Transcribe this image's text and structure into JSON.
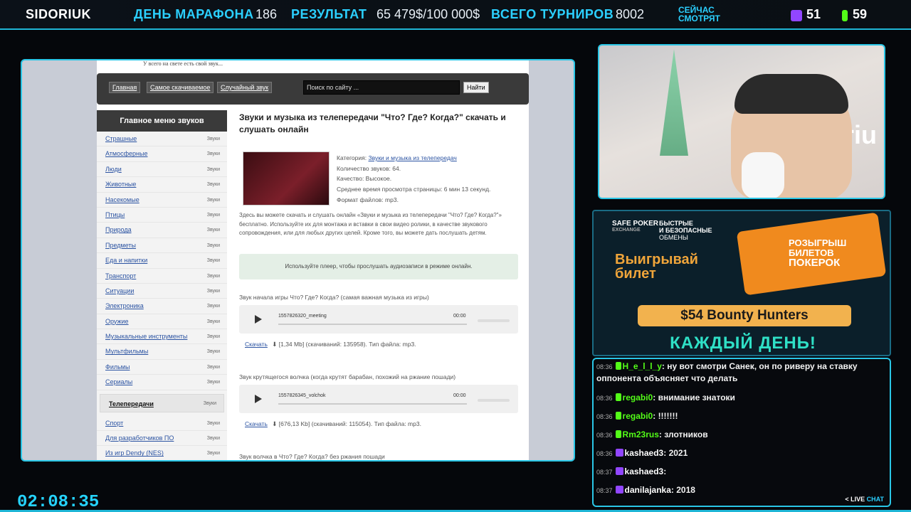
{
  "topbar": {
    "brand": "SIDORIUK",
    "marathon_label": "ДЕНЬ МАРАФОНА",
    "marathon_value": "186",
    "result_label": "РЕЗУЛЬТАТ",
    "result_value": "65 479$/100 000$",
    "tournaments_label": "ВСЕГО ТУРНИРОВ",
    "tournaments_value": "8002",
    "watching_line1": "СЕЙЧАС",
    "watching_line2": "СМОТРЯТ",
    "twitch_count": "51",
    "kick_count": "59"
  },
  "site": {
    "tagline": "У всего на свете есть свой звук...",
    "nav": [
      "Главная",
      "Самое скачиваемое",
      "Случайный звук"
    ],
    "search_placeholder": "Поиск по сайту ...",
    "search_button": "Найти",
    "menu_title": "Главное меню звуков",
    "menu_items": [
      {
        "label": "Страшные",
        "tag": "Звуки"
      },
      {
        "label": "Атмосферные",
        "tag": "Звуки"
      },
      {
        "label": "Люди",
        "tag": "Звуки"
      },
      {
        "label": "Животные",
        "tag": "Звуки"
      },
      {
        "label": "Насекомые",
        "tag": "Звуки"
      },
      {
        "label": "Птицы",
        "tag": "Звуки"
      },
      {
        "label": "Природа",
        "tag": "Звуки"
      },
      {
        "label": "Предметы",
        "tag": "Звуки"
      },
      {
        "label": "Еда и напитки",
        "tag": "Звуки"
      },
      {
        "label": "Транспорт",
        "tag": "Звуки"
      },
      {
        "label": "Ситуации",
        "tag": "Звуки"
      },
      {
        "label": "Электроника",
        "tag": "Звуки"
      },
      {
        "label": "Оружие",
        "tag": "Звуки"
      },
      {
        "label": "Музыкальные инструменты",
        "tag": "Звуки"
      },
      {
        "label": "Мультфильмы",
        "tag": "Звуки"
      },
      {
        "label": "Фильмы",
        "tag": "Звуки"
      },
      {
        "label": "Сериалы",
        "tag": "Звуки"
      },
      {
        "label": "Телепередачи",
        "tag": "Звуки",
        "active": true
      },
      {
        "label": "Спорт",
        "tag": "Звуки"
      },
      {
        "label": "Для разработчиков ПО",
        "tag": "Звуки"
      },
      {
        "label": "Из игр Dendy (NES)",
        "tag": "Звуки"
      }
    ],
    "page_title": "Звуки и музыка из телепередачи \"Что? Где? Когда?\" скачать и слушать онлайн",
    "meta": {
      "category_label": "Категория:",
      "category_link": "Звуки и музыка из телепередач",
      "count": "Количество звуков: 64.",
      "quality": "Качество: Высокое.",
      "avg_time": "Среднее время просмотра страницы: 6 мин 13 секунд.",
      "format": "Формат файлов: mp3."
    },
    "description": "Здесь вы можете скачать и слушать онлайн «Звуки и музыка из телепередачи \"Что? Где? Когда?\"» бесплатно. Используйте их для монтажа и вставки в свои видео ролики, в качестве звукового сопровождения, или для любых других целей. Кроме того, вы можете дать послушать детям.",
    "info_box": "Используйте плеер, чтобы прослушать аудиозаписи в режиме онлайн.",
    "tracks": [
      {
        "title": "Звук начала игры Что? Где? Когда? (самая важная музыка из игры)",
        "file": "1557826320_meeting",
        "time": "00:00",
        "download": "Скачать",
        "details": "[1,34 Mb] (скачиваний: 135958). Тип файла: mp3."
      },
      {
        "title": "Звук крутящегося волчка (когда крутят барабан, похожий на ржание пошади)",
        "file": "1557826345_volchok",
        "time": "00:00",
        "download": "Скачать",
        "details": "[676,13 Kb] (скачиваний: 115054). Тип файла: mp3."
      },
      {
        "title": "Звук волчка в Что? Где? Когда? без ржания пошади"
      }
    ]
  },
  "ad": {
    "brand_a": "SAFE POKER",
    "brand_b": "EXCHANGE",
    "tagline_1": "БЫСТРЫЕ",
    "tagline_2": "И БЕЗОПАСНЫЕ",
    "tagline_3": "ОБМЕНЫ",
    "win_1": "Выигрывай",
    "win_2": "билет",
    "ticket_1": "РОЗЫГРЫШ",
    "ticket_2": "БИЛЕТОВ",
    "ticket_3": "ПОКЕРОК",
    "bounty": "$54 Bounty Hunters",
    "daily": "КАЖДЫЙ ДЕНЬ!"
  },
  "cam": {
    "sign": "doriu"
  },
  "chat": {
    "messages": [
      {
        "time": "08:36",
        "user": "H_e_l_l_y",
        "platform": "kick",
        "text": "ну вот смотри Санек, он по риверу на ставку оппонента объясняет что делать"
      },
      {
        "time": "08:36",
        "user": "regabi0",
        "platform": "kick",
        "text": "внимание знатоки"
      },
      {
        "time": "08:36",
        "user": "regabi0",
        "platform": "kick",
        "text": "!!!!!!!"
      },
      {
        "time": "08:36",
        "user": "Rm23rus",
        "platform": "kick",
        "text": "злотников"
      },
      {
        "time": "08:36",
        "user": "kashaed3",
        "platform": "twitch",
        "text": "2021"
      },
      {
        "time": "08:37",
        "user": "kashaed3",
        "platform": "twitch",
        "text": ""
      },
      {
        "time": "08:37",
        "user": "danilajanka",
        "platform": "twitch",
        "text": "2018"
      }
    ],
    "live_label": "< LIVE",
    "chat_label": "CHAT"
  },
  "timer": "02:08:35"
}
